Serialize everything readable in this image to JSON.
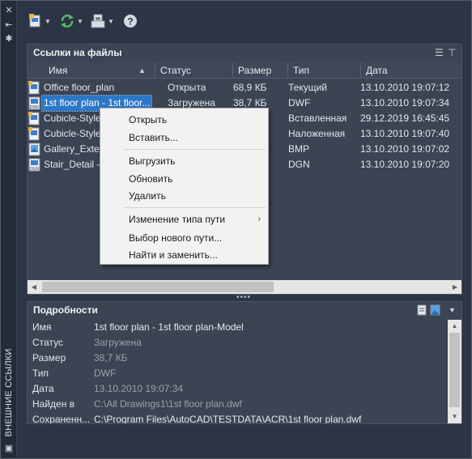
{
  "palette_title": "ВНЕШНИЕ ССЫЛКИ",
  "toolbar": {
    "attach_icon": "attach-dwg-icon",
    "refresh_icon": "refresh-icon",
    "change_path_icon": "change-path-icon",
    "help_icon": "help-icon"
  },
  "file_refs": {
    "title": "Ссылки на файлы",
    "columns": [
      "Имя",
      "Статус",
      "Размер",
      "Тип",
      "Дата"
    ],
    "rows": [
      {
        "name": "Office floor_plan",
        "status": "Открыта",
        "size": "68,9 КБ",
        "type": "Текущий",
        "date": "13.10.2010 19:07:12",
        "icon": "dwg-file-icon"
      },
      {
        "name": "1st floor plan - 1st floor...",
        "status": "Загружена",
        "size": "38,7 КБ",
        "type": "DWF",
        "date": "13.10.2010 19:07:34",
        "icon": "dwf-file-icon",
        "selected": true
      },
      {
        "name": "Cubicle-Style",
        "status": "",
        "size": "",
        "type": "Вставленная",
        "date": "29.12.2019 16:45:45",
        "icon": "dwg-file-icon"
      },
      {
        "name": "Cubicle-Style",
        "status": "",
        "size": "",
        "type": "Наложенная",
        "date": "13.10.2010 19:07:40",
        "icon": "dwg-file-icon"
      },
      {
        "name": "Gallery_Exteri",
        "status": "",
        "size": "",
        "type": "BMP",
        "date": "13.10.2010 19:07:02",
        "icon": "image-file-icon"
      },
      {
        "name": "Stair_Detail -",
        "status": "",
        "size": "",
        "type": "DGN",
        "date": "13.10.2010 19:07:20",
        "icon": "dgn-file-icon"
      }
    ]
  },
  "context_menu": {
    "open": "Открыть",
    "insert": "Вставить...",
    "unload": "Выгрузить",
    "reload": "Обновить",
    "delete": "Удалить",
    "change_path_type": "Изменение типа пути",
    "select_new_path": "Выбор нового пути...",
    "find_replace": "Найти и заменить..."
  },
  "details": {
    "title": "Подробности",
    "rows": [
      {
        "label": "Имя",
        "value": "1st floor plan - 1st floor plan-Model"
      },
      {
        "label": "Статус",
        "value": "Загружена"
      },
      {
        "label": "Размер",
        "value": "38,7 КБ"
      },
      {
        "label": "Тип",
        "value": "DWF"
      },
      {
        "label": "Дата",
        "value": "13.10.2010 19:07:34"
      },
      {
        "label": "Найден в",
        "value": "C:\\All Drawings1\\1st floor plan.dwf"
      },
      {
        "label": "Сохраненн...",
        "value": "C:\\Program Files\\AutoCAD\\TESTDATA\\ACR\\1st floor plan.dwf"
      }
    ]
  },
  "colors": {
    "background": "#2c3545",
    "panel": "#3b4453",
    "selection": "#2b78c9",
    "menu": "#f2f2f2"
  }
}
